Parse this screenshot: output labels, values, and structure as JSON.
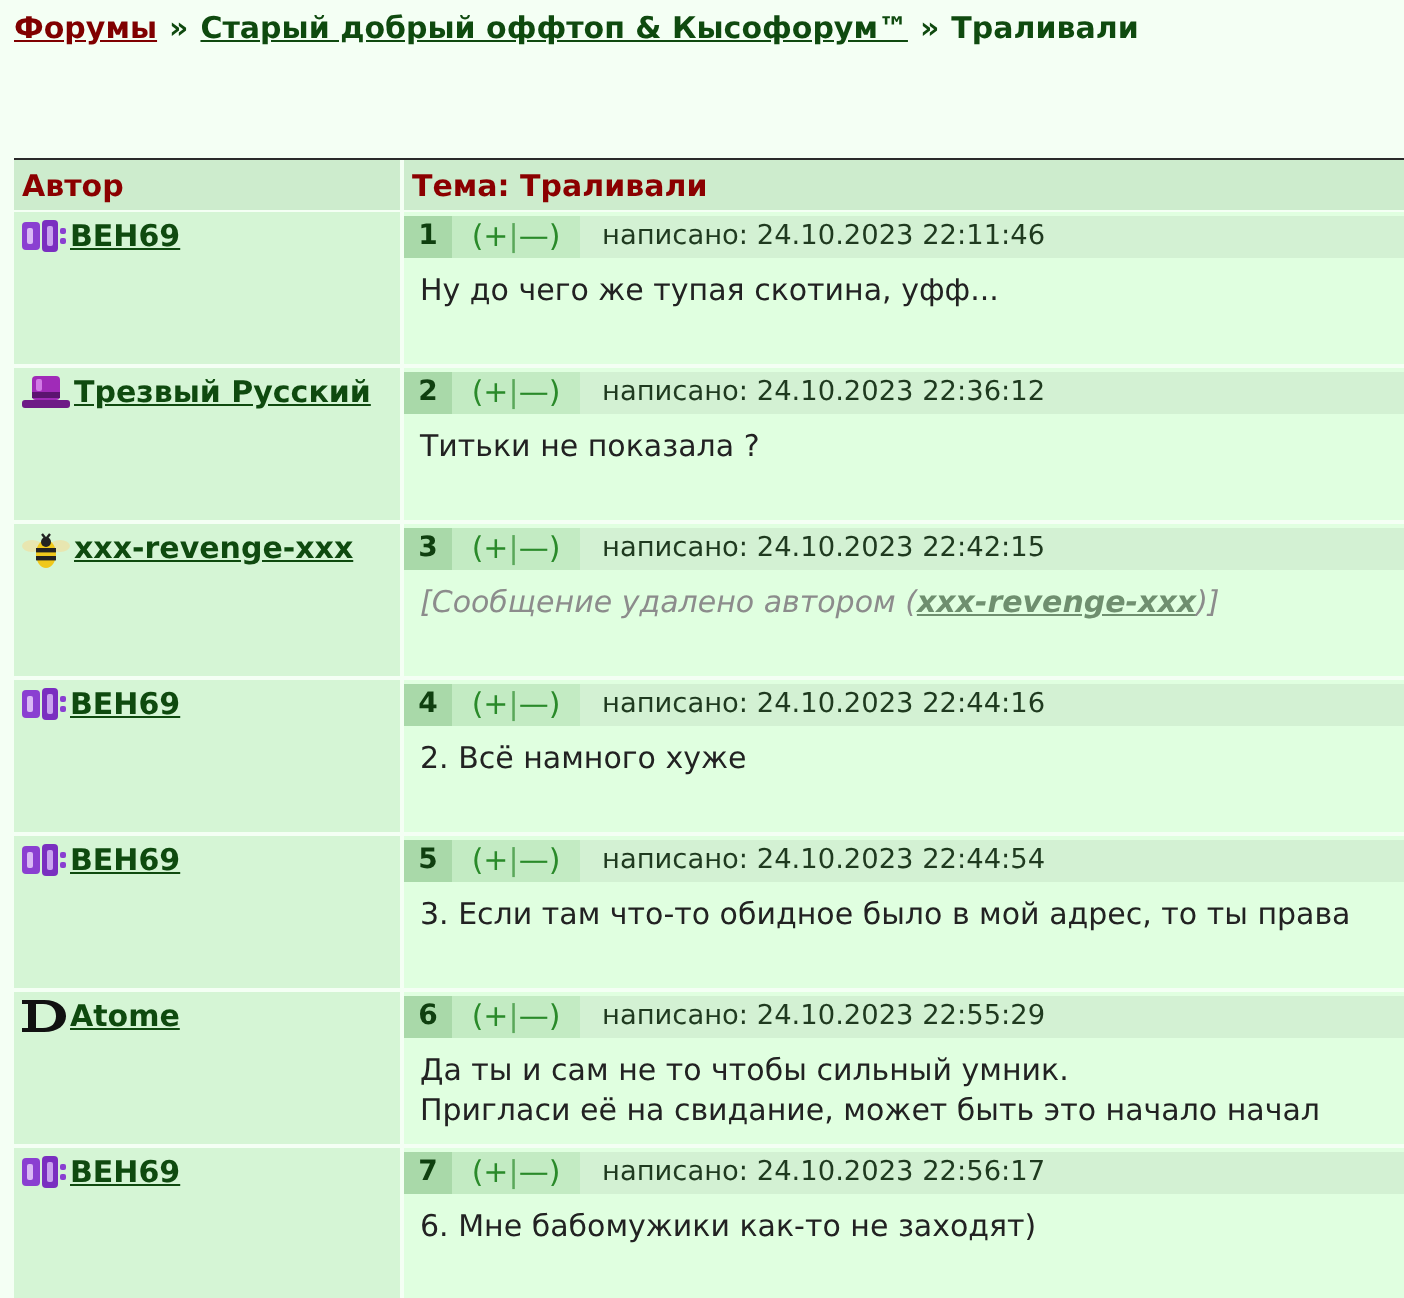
{
  "breadcrumb": [
    {
      "text": "Форумы",
      "kind": "home"
    },
    {
      "text": "»",
      "kind": "separator"
    },
    {
      "text": "Старый добрый оффтоп & Кысофорум™",
      "kind": "forum"
    },
    {
      "text": "»",
      "kind": "separator"
    },
    {
      "text": "Траливали",
      "kind": "current"
    }
  ],
  "table": {
    "columns": [
      "Автор",
      "Тема: Траливали"
    ]
  },
  "posts": [
    {
      "author": "BEH69",
      "avatar": {
        "kind": "blocks"
      },
      "number": "1",
      "vote": {
        "open": "(",
        "up": "+",
        "divider": "|",
        "down": "—",
        "close": ")"
      },
      "posted": "написано: 24.10.2023 22:11:46",
      "kind": "message",
      "text": "Ну до чего же тупая скотина, уфф..."
    },
    {
      "author": "Трезвый Русский",
      "avatar": {
        "kind": "hat"
      },
      "number": "2",
      "vote": {
        "open": "(",
        "up": "+",
        "divider": "|",
        "down": "—",
        "close": ")"
      },
      "posted": "написано: 24.10.2023 22:36:12",
      "kind": "message",
      "text": "Титьки не показала ?"
    },
    {
      "author": "xxx-revenge-xxx",
      "avatar": {
        "kind": "bee"
      },
      "number": "3",
      "vote": {
        "open": "(",
        "up": "+",
        "divider": "|",
        "down": "—",
        "close": ")"
      },
      "posted": "написано: 24.10.2023 22:42:15",
      "kind": "deleted",
      "notice_before": "[Сообщение удалено автором (",
      "notice_link": "xxx-revenge-xxx",
      "notice_after": ")]"
    },
    {
      "author": "BEH69",
      "avatar": {
        "kind": "blocks"
      },
      "number": "4",
      "vote": {
        "open": "(",
        "up": "+",
        "divider": "|",
        "down": "—",
        "close": ")"
      },
      "posted": "написано: 24.10.2023 22:44:16",
      "kind": "message",
      "text": "2. Всё намного хуже"
    },
    {
      "author": "BEH69",
      "avatar": {
        "kind": "blocks"
      },
      "number": "5",
      "vote": {
        "open": "(",
        "up": "+",
        "divider": "|",
        "down": "—",
        "close": ")"
      },
      "posted": "написано: 24.10.2023 22:44:54",
      "kind": "message",
      "text": "3. Если там что-то обидное было в мой адрес, то ты права"
    },
    {
      "author": "Atome",
      "avatar": {
        "kind": "letter"
      },
      "number": "6",
      "vote": {
        "open": "(",
        "up": "+",
        "divider": "|",
        "down": "—",
        "close": ")"
      },
      "posted": "написано: 24.10.2023 22:55:29",
      "kind": "message",
      "text": "Да ты и сам не то чтобы сильный умник.\nПригласи её на свидание, может быть это начало начал"
    },
    {
      "author": "BEH69",
      "avatar": {
        "kind": "blocks"
      },
      "number": "7",
      "vote": {
        "open": "(",
        "up": "+",
        "divider": "|",
        "down": "—",
        "close": ")"
      },
      "posted": "написано: 24.10.2023 22:56:17",
      "kind": "message",
      "text": "6. Мне бабомужики как-то не заходят)"
    }
  ]
}
